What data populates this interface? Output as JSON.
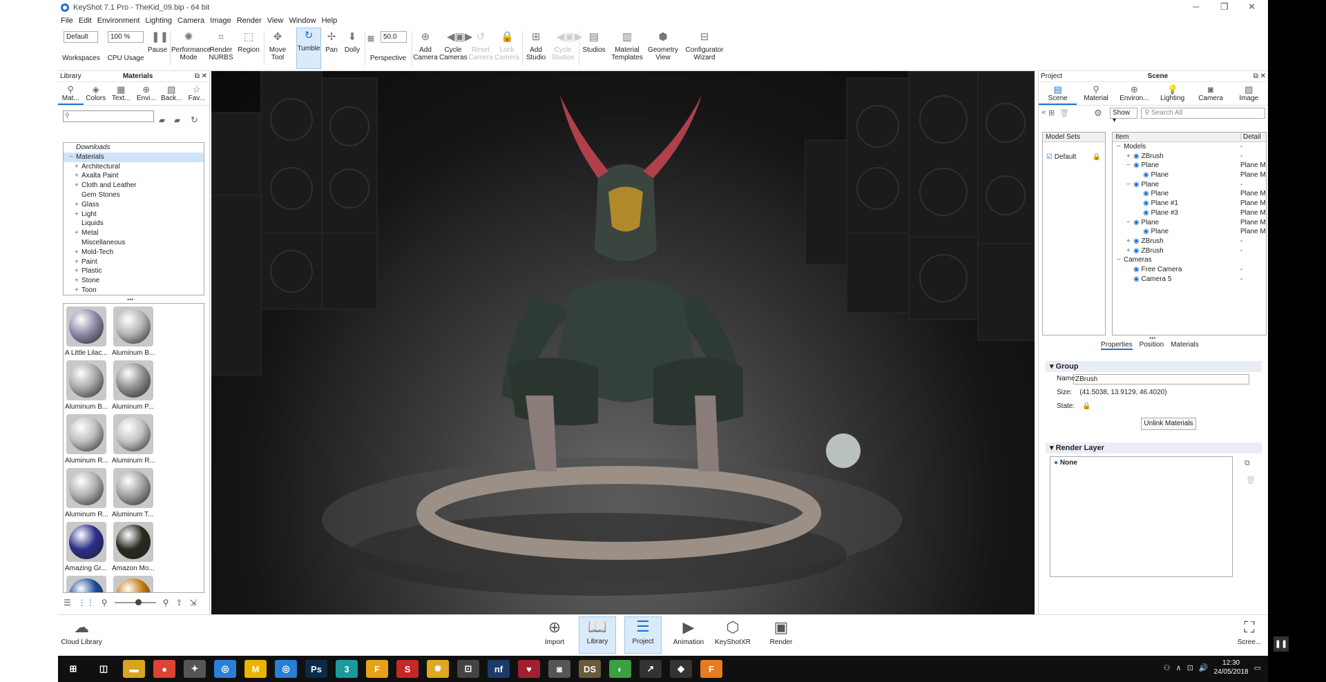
{
  "window": {
    "title": "KeyShot 7.1 Pro  - TheKid_09.bip  - 64 bit",
    "min": "─",
    "max": "❐",
    "close": "✕"
  },
  "menu": [
    "File",
    "Edit",
    "Environment",
    "Lighting",
    "Camera",
    "Image",
    "Render",
    "View",
    "Window",
    "Help"
  ],
  "toolbar": {
    "workspace_value": "Default",
    "cpu_value": "100 %",
    "perspective_value": "50.0",
    "buttons": {
      "workspaces": "Workspaces",
      "cpu": "CPU Usage",
      "pause": "Pause",
      "performance": "Performance Mode",
      "render_nurbs": "Render NURBS",
      "region": "Region",
      "move_tool": "Move Tool",
      "tumble": "Tumble",
      "pan": "Pan",
      "dolly": "Dolly",
      "perspective": "Perspective",
      "add_camera": "Add Camera",
      "cycle_cameras": "Cycle Cameras",
      "reset_camera": "Reset Camera",
      "lock_camera": "Lock Camera",
      "add_studio": "Add Studio",
      "cycle_studios": "Cycle Studios",
      "studios": "Studios",
      "material_templates": "Material Templates",
      "geometry_view": "Geometry View",
      "configurator": "Configurator Wizard"
    }
  },
  "library": {
    "panel_label": "Library",
    "title": "Materials",
    "tabs": [
      "Mat...",
      "Colors",
      "Text...",
      "Envi...",
      "Back...",
      "Fav..."
    ],
    "tree": [
      {
        "label": "Downloads",
        "indent": 1,
        "italic": true,
        "toggle": ""
      },
      {
        "label": "Materials",
        "indent": 1,
        "italic": false,
        "toggle": "−",
        "selected": true
      },
      {
        "label": "Architectural",
        "indent": 2,
        "toggle": "+"
      },
      {
        "label": "Axalta Paint",
        "indent": 2,
        "toggle": "+"
      },
      {
        "label": "Cloth and Leather",
        "indent": 2,
        "toggle": "+"
      },
      {
        "label": "Gem Stones",
        "indent": 2,
        "toggle": ""
      },
      {
        "label": "Glass",
        "indent": 2,
        "toggle": "+"
      },
      {
        "label": "Light",
        "indent": 2,
        "toggle": "+"
      },
      {
        "label": "Liquids",
        "indent": 2,
        "toggle": ""
      },
      {
        "label": "Metal",
        "indent": 2,
        "toggle": "+"
      },
      {
        "label": "Miscellaneous",
        "indent": 2,
        "toggle": ""
      },
      {
        "label": "Mold-Tech",
        "indent": 2,
        "toggle": "+"
      },
      {
        "label": "Paint",
        "indent": 2,
        "toggle": "+"
      },
      {
        "label": "Plastic",
        "indent": 2,
        "toggle": "+"
      },
      {
        "label": "Stone",
        "indent": 2,
        "toggle": "+"
      },
      {
        "label": "Toon",
        "indent": 2,
        "toggle": "+"
      }
    ],
    "thumbs": [
      {
        "label": "A Little Lilac...",
        "color": "#8e8aa8"
      },
      {
        "label": "Aluminum B...",
        "color": "#b5b5b5"
      },
      {
        "label": "Aluminum B...",
        "color": "#a9a9a9"
      },
      {
        "label": "Aluminum P...",
        "color": "#8f8f8f"
      },
      {
        "label": "Aluminum R...",
        "color": "#bdbdbd"
      },
      {
        "label": "Aluminum R...",
        "color": "#c2c2c2"
      },
      {
        "label": "Aluminum R...",
        "color": "#b0b0b0"
      },
      {
        "label": "Aluminum T...",
        "color": "#a2a2a2"
      },
      {
        "label": "Amazing Gr...",
        "color": "#2b2f8a"
      },
      {
        "label": "Amazon Mo...",
        "color": "#2a2a20"
      },
      {
        "label": "",
        "color": "#1b4a9a"
      },
      {
        "label": "",
        "color": "#c47a10"
      }
    ]
  },
  "project": {
    "panel_label": "Project",
    "title": "Scene",
    "tabs": [
      "Scene",
      "Material",
      "Environ...",
      "Lighting",
      "Camera",
      "Image"
    ],
    "show": "Show",
    "search_placeholder": "Search All",
    "model_sets_header": "Model Sets",
    "model_set": "Default",
    "item_header": "Item",
    "detail_header": "Detail",
    "items": [
      {
        "label": "Models",
        "indent": 0,
        "toggle": "−",
        "detail": "-"
      },
      {
        "label": "ZBrush",
        "indent": 1,
        "toggle": "+",
        "detail": "-"
      },
      {
        "label": "Plane",
        "indent": 1,
        "toggle": "−",
        "detail": "Plane M"
      },
      {
        "label": "Plane",
        "indent": 2,
        "toggle": "",
        "detail": "Plane M"
      },
      {
        "label": "Plane",
        "indent": 1,
        "toggle": "−",
        "detail": "-"
      },
      {
        "label": "Plane",
        "indent": 2,
        "toggle": "",
        "detail": "Plane M"
      },
      {
        "label": "Plane #1",
        "indent": 2,
        "toggle": "",
        "detail": "Plane M"
      },
      {
        "label": "Plane #3",
        "indent": 2,
        "toggle": "",
        "detail": "Plane M"
      },
      {
        "label": "Plane",
        "indent": 1,
        "toggle": "−",
        "detail": "Plane M"
      },
      {
        "label": "Plane",
        "indent": 2,
        "toggle": "",
        "detail": "Plane M"
      },
      {
        "label": "ZBrush",
        "indent": 1,
        "toggle": "+",
        "detail": "-"
      },
      {
        "label": "ZBrush",
        "indent": 1,
        "toggle": "+",
        "detail": "-"
      },
      {
        "label": "Cameras",
        "indent": 0,
        "toggle": "−",
        "detail": ""
      },
      {
        "label": "Free Camera",
        "indent": 1,
        "toggle": "",
        "detail": "-"
      },
      {
        "label": "Camera 5",
        "indent": 1,
        "toggle": "",
        "detail": "-"
      }
    ],
    "sub_tabs": [
      "Properties",
      "Position",
      "Materials"
    ],
    "group": {
      "title": "Group",
      "name_label": "Name:",
      "name_value": "ZBrush",
      "size_label": "Size:",
      "size_value": "(41.5038, 13.9129, 46.4020)",
      "state_label": "State:",
      "unlink": "Unlink Materials"
    },
    "render_layer": {
      "title": "Render Layer",
      "item": "None"
    }
  },
  "bottom": {
    "cloud": "Cloud Library",
    "import": "Import",
    "library": "Library",
    "project": "Project",
    "animation": "Animation",
    "keyshotxr": "KeyShotXR",
    "render": "Render",
    "screenshot": "Scree..."
  },
  "taskbar": {
    "time": "12:30",
    "date": "24/05/2018",
    "apps": [
      {
        "glyph": "⊞",
        "color": "#101010"
      },
      {
        "glyph": "◫",
        "color": "#101010"
      },
      {
        "glyph": "▬",
        "color": "#d9a520"
      },
      {
        "glyph": "●",
        "color": "#db4437"
      },
      {
        "glyph": "✦",
        "color": "#555"
      },
      {
        "glyph": "◎",
        "color": "#2a7fd4"
      },
      {
        "glyph": "M",
        "color": "#e9b400"
      },
      {
        "glyph": "◎",
        "color": "#2a7fd4"
      },
      {
        "glyph": "Ps",
        "color": "#0a2a4a"
      },
      {
        "glyph": "3",
        "color": "#1a9a9a"
      },
      {
        "glyph": "F",
        "color": "#e8a018"
      },
      {
        "glyph": "S",
        "color": "#c62828"
      },
      {
        "glyph": "✹",
        "color": "#e0a820"
      },
      {
        "glyph": "⊡",
        "color": "#444"
      },
      {
        "glyph": "nf",
        "color": "#1a3a6a"
      },
      {
        "glyph": "♥",
        "color": "#a02030"
      },
      {
        "glyph": "◙",
        "color": "#555"
      },
      {
        "glyph": "DS",
        "color": "#6a5a3a"
      },
      {
        "glyph": "◐",
        "color": "#3aa040"
      },
      {
        "glyph": "↗",
        "color": "#333"
      },
      {
        "glyph": "◆",
        "color": "#333"
      },
      {
        "glyph": "F",
        "color": "#e87a20"
      }
    ]
  }
}
